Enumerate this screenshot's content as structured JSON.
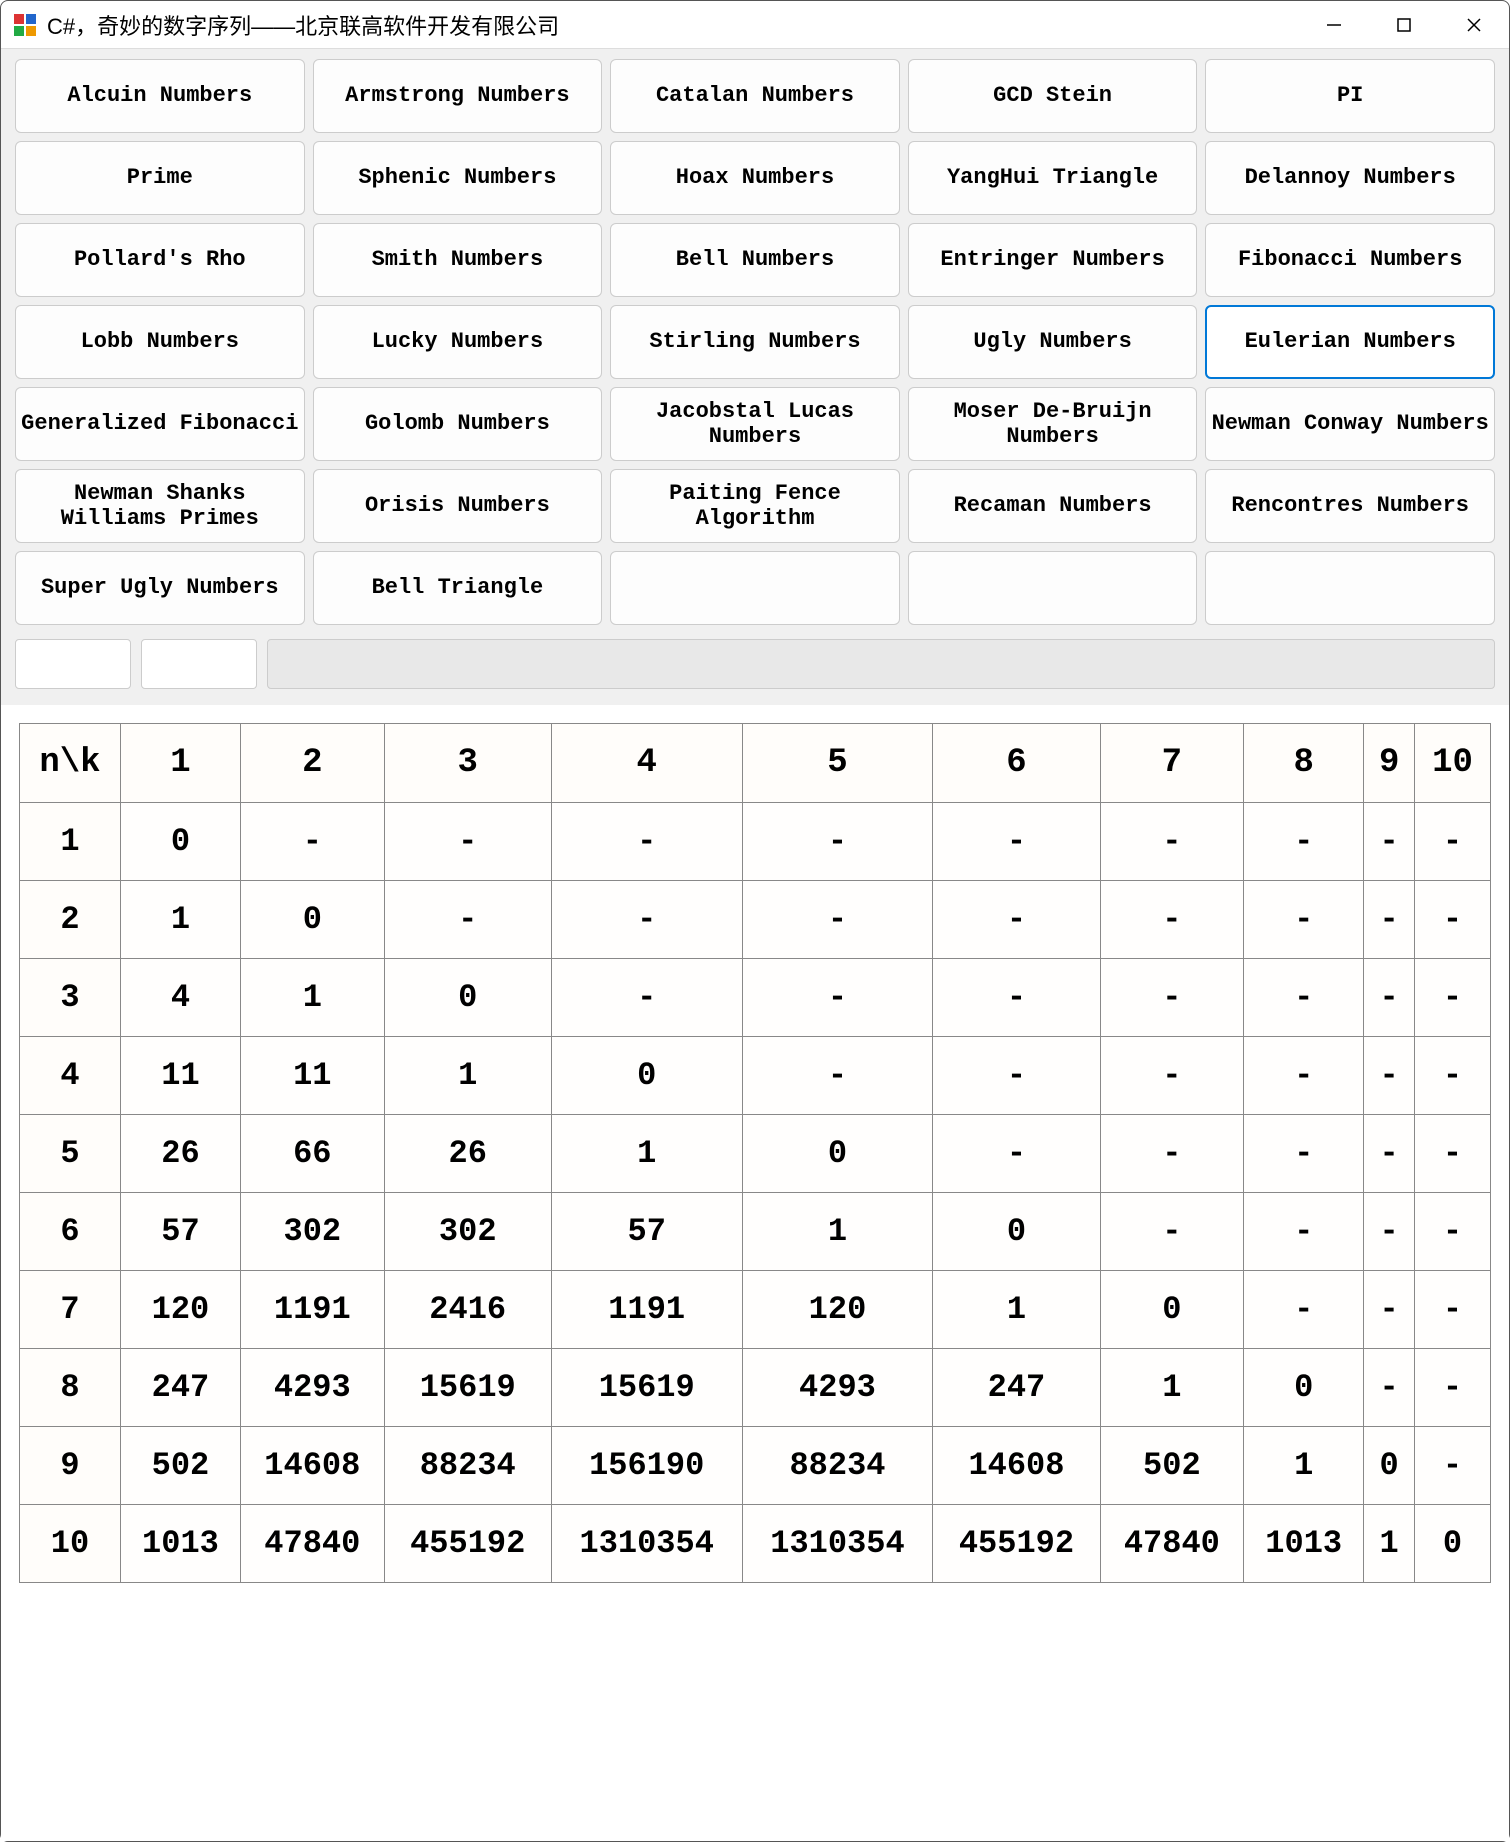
{
  "window": {
    "title": "C#，奇妙的数字序列——北京联高软件开发有限公司"
  },
  "buttons": [
    {
      "label": "Alcuin Numbers",
      "selected": false
    },
    {
      "label": "Armstrong Numbers",
      "selected": false
    },
    {
      "label": "Catalan Numbers",
      "selected": false
    },
    {
      "label": "GCD Stein",
      "selected": false
    },
    {
      "label": "PI",
      "selected": false
    },
    {
      "label": "Prime",
      "selected": false
    },
    {
      "label": "Sphenic Numbers",
      "selected": false
    },
    {
      "label": "Hoax Numbers",
      "selected": false
    },
    {
      "label": "YangHui Triangle",
      "selected": false
    },
    {
      "label": "Delannoy Numbers",
      "selected": false
    },
    {
      "label": "Pollard's Rho",
      "selected": false
    },
    {
      "label": "Smith Numbers",
      "selected": false
    },
    {
      "label": "Bell Numbers",
      "selected": false
    },
    {
      "label": "Entringer Numbers",
      "selected": false
    },
    {
      "label": "Fibonacci Numbers",
      "selected": false
    },
    {
      "label": "Lobb Numbers",
      "selected": false
    },
    {
      "label": "Lucky Numbers",
      "selected": false
    },
    {
      "label": "Stirling Numbers",
      "selected": false
    },
    {
      "label": "Ugly Numbers",
      "selected": false
    },
    {
      "label": "Eulerian Numbers",
      "selected": true
    },
    {
      "label": "Generalized Fibonacci",
      "selected": false
    },
    {
      "label": "Golomb Numbers",
      "selected": false
    },
    {
      "label": "Jacobstal Lucas Numbers",
      "selected": false
    },
    {
      "label": "Moser De-Bruijn Numbers",
      "selected": false
    },
    {
      "label": "Newman Conway Numbers",
      "selected": false
    },
    {
      "label": "Newman Shanks Williams Primes",
      "selected": false
    },
    {
      "label": "Orisis Numbers",
      "selected": false
    },
    {
      "label": "Paiting Fence Algorithm",
      "selected": false
    },
    {
      "label": "Recaman Numbers",
      "selected": false
    },
    {
      "label": "Rencontres Numbers",
      "selected": false
    },
    {
      "label": "Super Ugly Numbers",
      "selected": false
    },
    {
      "label": "Bell Triangle",
      "selected": false
    },
    {
      "label": "",
      "selected": false,
      "empty": true
    },
    {
      "label": "",
      "selected": false,
      "empty": true
    },
    {
      "label": "",
      "selected": false,
      "empty": true
    }
  ],
  "inputs": {
    "field1": "",
    "field2": ""
  },
  "table": {
    "corner": "n\\k",
    "cols": [
      "1",
      "2",
      "3",
      "4",
      "5",
      "6",
      "7",
      "8",
      "9",
      "10"
    ],
    "rows": [
      {
        "n": "1",
        "v": [
          "0",
          "-",
          "-",
          "-",
          "-",
          "-",
          "-",
          "-",
          "-",
          "-"
        ]
      },
      {
        "n": "2",
        "v": [
          "1",
          "0",
          "-",
          "-",
          "-",
          "-",
          "-",
          "-",
          "-",
          "-"
        ]
      },
      {
        "n": "3",
        "v": [
          "4",
          "1",
          "0",
          "-",
          "-",
          "-",
          "-",
          "-",
          "-",
          "-"
        ]
      },
      {
        "n": "4",
        "v": [
          "11",
          "11",
          "1",
          "0",
          "-",
          "-",
          "-",
          "-",
          "-",
          "-"
        ]
      },
      {
        "n": "5",
        "v": [
          "26",
          "66",
          "26",
          "1",
          "0",
          "-",
          "-",
          "-",
          "-",
          "-"
        ]
      },
      {
        "n": "6",
        "v": [
          "57",
          "302",
          "302",
          "57",
          "1",
          "0",
          "-",
          "-",
          "-",
          "-"
        ]
      },
      {
        "n": "7",
        "v": [
          "120",
          "1191",
          "2416",
          "1191",
          "120",
          "1",
          "0",
          "-",
          "-",
          "-"
        ]
      },
      {
        "n": "8",
        "v": [
          "247",
          "4293",
          "15619",
          "15619",
          "4293",
          "247",
          "1",
          "0",
          "-",
          "-"
        ]
      },
      {
        "n": "9",
        "v": [
          "502",
          "14608",
          "88234",
          "156190",
          "88234",
          "14608",
          "502",
          "1",
          "0",
          "-"
        ]
      },
      {
        "n": "10",
        "v": [
          "1013",
          "47840",
          "455192",
          "1310354",
          "1310354",
          "455192",
          "47840",
          "1013",
          "1",
          "0"
        ]
      }
    ]
  }
}
